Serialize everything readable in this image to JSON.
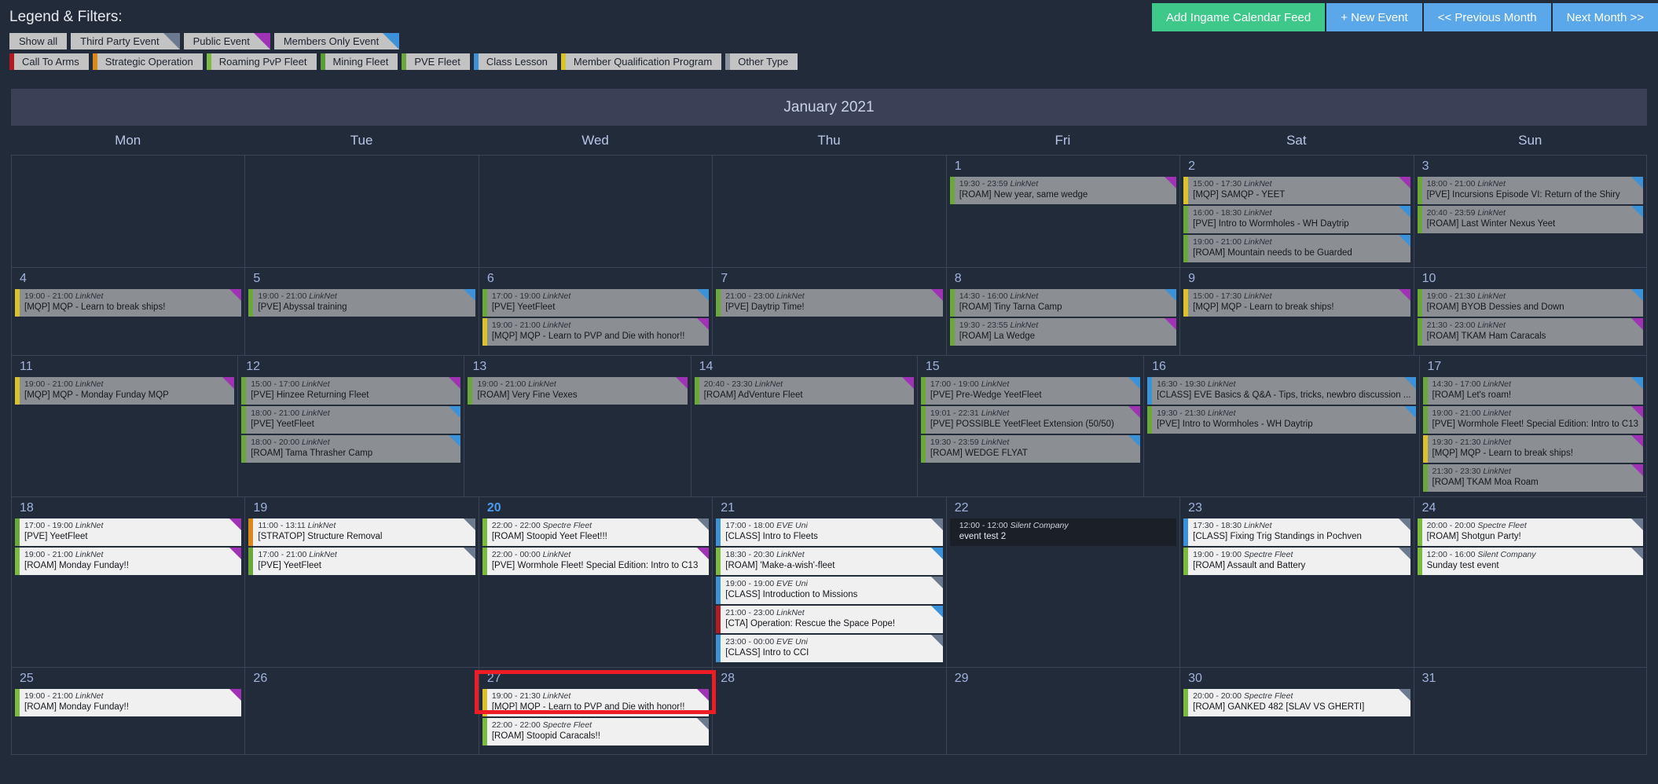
{
  "legend": {
    "title": "Legend & Filters:",
    "visibility_filters": [
      {
        "label": "Show all",
        "corner": null
      },
      {
        "label": "Third Party Event",
        "corner": "#6b7a8f"
      },
      {
        "label": "Public Event",
        "corner": "#a033b5"
      },
      {
        "label": "Members Only Event",
        "corner": "#3b92d8"
      }
    ],
    "category_filters": [
      {
        "label": "Call To Arms",
        "color": "#b01c22"
      },
      {
        "label": "Strategic Operation",
        "color": "#d9881b"
      },
      {
        "label": "Roaming PvP Fleet",
        "color": "#7cbb3f"
      },
      {
        "label": "Mining Fleet",
        "color": "#5d9b35"
      },
      {
        "label": "PVE Fleet",
        "color": "#6aa83a"
      },
      {
        "label": "Class Lesson",
        "color": "#3b92d8"
      },
      {
        "label": "Member Qualification Program",
        "color": "#d9c22b"
      },
      {
        "label": "Other Type",
        "color": "#8a949f"
      }
    ]
  },
  "actions": [
    {
      "label": "Add Ingame Calendar Feed",
      "style": "green"
    },
    {
      "label": "+ New Event",
      "style": "blue"
    },
    {
      "label": "<< Previous Month",
      "style": "blue"
    },
    {
      "label": "Next Month >>",
      "style": "blue"
    }
  ],
  "calendar": {
    "month_title": "January 2021",
    "weekdays": [
      "Mon",
      "Tue",
      "Wed",
      "Thu",
      "Fri",
      "Sat",
      "Sun"
    ],
    "today": 20,
    "weeks": [
      [
        {
          "day": ""
        },
        {
          "day": ""
        },
        {
          "day": ""
        },
        {
          "day": ""
        },
        {
          "day": "1",
          "events": [
            {
              "time": "19:30 - 23:59",
              "source": "LinkNet",
              "title": "[ROAM] New year, same wedge",
              "color": "#6aa83a",
              "corner": "#a033b5",
              "state": "past"
            }
          ]
        },
        {
          "day": "2",
          "events": [
            {
              "time": "15:00 - 17:30",
              "source": "LinkNet",
              "title": "[MQP] SAMQP - YEET",
              "color": "#d9c22b",
              "corner": "#a033b5",
              "state": "past"
            },
            {
              "time": "16:00 - 18:30",
              "source": "LinkNet",
              "title": "[PVE] Intro to Wormholes - WH Daytrip",
              "color": "#6aa83a",
              "corner": "#3b92d8",
              "state": "past"
            },
            {
              "time": "19:00 - 21:00",
              "source": "LinkNet",
              "title": "[ROAM] Mountain needs to be Guarded",
              "color": "#6aa83a",
              "corner": "#3b92d8",
              "state": "past"
            }
          ]
        },
        {
          "day": "3",
          "events": [
            {
              "time": "18:00 - 21:00",
              "source": "LinkNet",
              "title": "[PVE] Incursions Episode VI: Return of the Shiry",
              "color": "#6aa83a",
              "corner": "#3b92d8",
              "state": "past"
            },
            {
              "time": "20:40 - 23:59",
              "source": "LinkNet",
              "title": "[ROAM] Last Winter Nexus Yeet",
              "color": "#6aa83a",
              "corner": "#3b92d8",
              "state": "past"
            }
          ]
        }
      ],
      [
        {
          "day": "4",
          "events": [
            {
              "time": "19:00 - 21:00",
              "source": "LinkNet",
              "title": "[MQP] MQP - Learn to break ships!",
              "color": "#d9c22b",
              "corner": "#a033b5",
              "state": "past"
            }
          ]
        },
        {
          "day": "5",
          "events": [
            {
              "time": "19:00 - 21:00",
              "source": "LinkNet",
              "title": "[PVE] Abyssal training",
              "color": "#6aa83a",
              "corner": "#3b92d8",
              "state": "past"
            }
          ]
        },
        {
          "day": "6",
          "events": [
            {
              "time": "17:00 - 19:00",
              "source": "LinkNet",
              "title": "[PVE] YeetFleet",
              "color": "#6aa83a",
              "corner": "#3b92d8",
              "state": "past"
            },
            {
              "time": "19:00 - 21:00",
              "source": "LinkNet",
              "title": "[MQP] MQP - Learn to PVP and Die with honor!!",
              "color": "#d9c22b",
              "corner": "#a033b5",
              "state": "past"
            }
          ]
        },
        {
          "day": "7",
          "events": [
            {
              "time": "21:00 - 23:00",
              "source": "LinkNet",
              "title": "[PVE] Daytrip Time!",
              "color": "#6aa83a",
              "corner": "#a033b5",
              "state": "past"
            }
          ]
        },
        {
          "day": "8",
          "events": [
            {
              "time": "14:30 - 16:00",
              "source": "LinkNet",
              "title": "[ROAM] Tiny Tarna Camp",
              "color": "#6aa83a",
              "corner": "#3b92d8",
              "state": "past"
            },
            {
              "time": "19:30 - 23:55",
              "source": "LinkNet",
              "title": "[ROAM] La Wedge",
              "color": "#6aa83a",
              "corner": "#a033b5",
              "state": "past"
            }
          ]
        },
        {
          "day": "9",
          "events": [
            {
              "time": "15:00 - 17:30",
              "source": "LinkNet",
              "title": "[MQP] MQP - Learn to break ships!",
              "color": "#d9c22b",
              "corner": "#a033b5",
              "state": "past"
            }
          ]
        },
        {
          "day": "10",
          "events": [
            {
              "time": "19:00 - 21:30",
              "source": "LinkNet",
              "title": "[ROAM] BYOB Dessies and Down",
              "color": "#6aa83a",
              "corner": "#3b92d8",
              "state": "past"
            },
            {
              "time": "21:30 - 23:00",
              "source": "LinkNet",
              "title": "[ROAM] TKAM Ham Caracals",
              "color": "#6aa83a",
              "corner": "#a033b5",
              "state": "past"
            }
          ]
        }
      ],
      [
        {
          "day": "11",
          "events": [
            {
              "time": "19:00 - 21:00",
              "source": "LinkNet",
              "title": "[MQP] MQP - Monday Funday MQP",
              "color": "#d9c22b",
              "corner": "#a033b5",
              "state": "past"
            }
          ]
        },
        {
          "day": "12",
          "events": [
            {
              "time": "15:00 - 17:00",
              "source": "LinkNet",
              "title": "[PVE] Hinzee Returning Fleet",
              "color": "#6aa83a",
              "corner": "#a033b5",
              "state": "past"
            },
            {
              "time": "18:00 - 21:00",
              "source": "LinkNet",
              "title": "[PVE] YeetFleet",
              "color": "#6aa83a",
              "corner": "#3b92d8",
              "state": "past"
            },
            {
              "time": "18:00 - 20:00",
              "source": "LinkNet",
              "title": "[ROAM] Tama Thrasher Camp",
              "color": "#6aa83a",
              "corner": "#3b92d8",
              "state": "past"
            }
          ]
        },
        {
          "day": "13",
          "events": [
            {
              "time": "19:00 - 21:00",
              "source": "LinkNet",
              "title": "[ROAM] Very Fine Vexes",
              "color": "#6aa83a",
              "corner": "#a033b5",
              "state": "past"
            }
          ]
        },
        {
          "day": "14",
          "events": [
            {
              "time": "20:40 - 23:30",
              "source": "LinkNet",
              "title": "[ROAM] AdVenture Fleet",
              "color": "#6aa83a",
              "corner": "#a033b5",
              "state": "past"
            }
          ]
        },
        {
          "day": "15",
          "events": [
            {
              "time": "17:00 - 19:00",
              "source": "LinkNet",
              "title": "[PVE] Pre-Wedge YeetFleet",
              "color": "#6aa83a",
              "corner": "#3b92d8",
              "state": "past"
            },
            {
              "time": "19:01 - 22:31",
              "source": "LinkNet",
              "title": "[PVE] POSSIBLE YeetFleet Extension (50/50)",
              "color": "#6aa83a",
              "corner": "#a033b5",
              "state": "past"
            },
            {
              "time": "19:30 - 23:59",
              "source": "LinkNet",
              "title": "[ROAM] WEDGE FLYAT",
              "color": "#6aa83a",
              "corner": "#3b92d8",
              "state": "past"
            }
          ]
        },
        {
          "day": "16",
          "events": [
            {
              "time": "16:30 - 19:30",
              "source": "LinkNet",
              "title": "[CLASS] EVE Basics & Q&A - Tips, tricks, newbro discussion ...",
              "color": "#3b92d8",
              "corner": "#3b92d8",
              "state": "past"
            },
            {
              "time": "19:30 - 21:30",
              "source": "LinkNet",
              "title": "[PVE] Intro to Wormholes - WH Daytrip",
              "color": "#6aa83a",
              "corner": "#3b92d8",
              "state": "past"
            }
          ]
        },
        {
          "day": "17",
          "events": [
            {
              "time": "14:30 - 17:00",
              "source": "LinkNet",
              "title": "[ROAM] Let's roam!",
              "color": "#6aa83a",
              "corner": "#3b92d8",
              "state": "past"
            },
            {
              "time": "19:00 - 21:00",
              "source": "LinkNet",
              "title": "[PVE] Wormhole Fleet! Special Edition: Intro to C13",
              "color": "#6aa83a",
              "corner": "#a033b5",
              "state": "past"
            },
            {
              "time": "19:30 - 21:30",
              "source": "LinkNet",
              "title": "[MQP] MQP - Learn to break ships!",
              "color": "#d9c22b",
              "corner": "#a033b5",
              "state": "past"
            },
            {
              "time": "21:30 - 23:30",
              "source": "LinkNet",
              "title": "[ROAM] TKAM Moa Roam",
              "color": "#6aa83a",
              "corner": "#a033b5",
              "state": "past"
            }
          ]
        }
      ],
      [
        {
          "day": "18",
          "events": [
            {
              "time": "17:00 - 19:00",
              "source": "LinkNet",
              "title": "[PVE] YeetFleet",
              "color": "#6aa83a",
              "corner": "#a033b5",
              "state": "future"
            },
            {
              "time": "19:00 - 21:00",
              "source": "LinkNet",
              "title": "[ROAM] Monday Funday!!",
              "color": "#7cbb3f",
              "corner": "#a033b5",
              "state": "future"
            }
          ]
        },
        {
          "day": "19",
          "events": [
            {
              "time": "11:00 - 13:11",
              "source": "LinkNet",
              "title": "[STRATOP] Structure Removal",
              "color": "#d9881b",
              "corner": "#6b7a8f",
              "state": "future"
            },
            {
              "time": "17:00 - 21:00",
              "source": "LinkNet",
              "title": "[PVE] YeetFleet",
              "color": "#6aa83a",
              "corner": "#6b7a8f",
              "state": "future"
            }
          ]
        },
        {
          "day": "20",
          "today": true,
          "events": [
            {
              "time": "22:00 - 22:00",
              "source": "Spectre Fleet",
              "title": "[ROAM] Stoopid Yeet Fleet!!!",
              "color": "#7cbb3f",
              "corner": "#6b7a8f",
              "state": "future"
            },
            {
              "time": "22:00 - 00:00",
              "source": "LinkNet",
              "title": "[PVE] Wormhole Fleet! Special Edition: Intro to C13",
              "color": "#7cbb3f",
              "corner": "#a033b5",
              "state": "future"
            }
          ]
        },
        {
          "day": "21",
          "events": [
            {
              "time": "17:00 - 18:00",
              "source": "EVE Uni",
              "title": "[CLASS] Intro to Fleets",
              "color": "#3b92d8",
              "corner": "#6b7a8f",
              "state": "future"
            },
            {
              "time": "18:30 - 20:30",
              "source": "LinkNet",
              "title": "[ROAM] 'Make-a-wish'-fleet",
              "color": "#7cbb3f",
              "corner": "#3b92d8",
              "state": "future"
            },
            {
              "time": "19:00 - 19:00",
              "source": "EVE Uni",
              "title": "[CLASS] Introduction to Missions",
              "color": "#3b92d8",
              "corner": "#6b7a8f",
              "state": "future"
            },
            {
              "time": "21:00 - 23:00",
              "source": "LinkNet",
              "title": "[CTA] Operation: Rescue the Space Pope!",
              "color": "#b01c22",
              "corner": "#3b92d8",
              "state": "future"
            },
            {
              "time": "23:00 - 00:00",
              "source": "EVE Uni",
              "title": "[CLASS] Intro to CCI",
              "color": "#3b92d8",
              "corner": "#6b7a8f",
              "state": "future"
            }
          ]
        },
        {
          "day": "22",
          "events": [
            {
              "time": "12:00 - 12:00",
              "source": "Silent Company",
              "title": "event test 2",
              "color": "#1b1f27",
              "corner": null,
              "state": "dark"
            }
          ]
        },
        {
          "day": "23",
          "events": [
            {
              "time": "17:30 - 18:30",
              "source": "LinkNet",
              "title": "[CLASS] Fixing Trig Standings in Pochven",
              "color": "#3b92d8",
              "corner": "#6b7a8f",
              "state": "future"
            },
            {
              "time": "19:00 - 19:00",
              "source": "Spectre Fleet",
              "title": "[ROAM] Assault and Battery",
              "color": "#7cbb3f",
              "corner": "#6b7a8f",
              "state": "future"
            }
          ]
        },
        {
          "day": "24",
          "events": [
            {
              "time": "20:00 - 20:00",
              "source": "Spectre Fleet",
              "title": "[ROAM] Shotgun Party!",
              "color": "#7cbb3f",
              "corner": "#6b7a8f",
              "state": "future"
            },
            {
              "time": "12:00 - 16:00",
              "source": "Silent Company",
              "title": "Sunday test event",
              "color": "#7cbb3f",
              "corner": "#6b7a8f",
              "state": "future"
            }
          ]
        }
      ],
      [
        {
          "day": "25",
          "events": [
            {
              "time": "19:00 - 21:00",
              "source": "LinkNet",
              "title": "[ROAM] Monday Funday!!",
              "color": "#7cbb3f",
              "corner": "#a033b5",
              "state": "future"
            }
          ]
        },
        {
          "day": "26",
          "events": []
        },
        {
          "day": "27",
          "highlighted": true,
          "events": [
            {
              "time": "19:00 - 21:30",
              "source": "LinkNet",
              "title": "[MQP] MQP - Learn to PVP and Die with honor!!",
              "color": "#d9c22b",
              "corner": "#a033b5",
              "state": "future"
            },
            {
              "time": "22:00 - 22:00",
              "source": "Spectre Fleet",
              "title": "[ROAM] Stoopid Caracals!!",
              "color": "#7cbb3f",
              "corner": "#6b7a8f",
              "state": "future"
            }
          ]
        },
        {
          "day": "28",
          "events": []
        },
        {
          "day": "29",
          "events": []
        },
        {
          "day": "30",
          "events": [
            {
              "time": "20:00 - 20:00",
              "source": "Spectre Fleet",
              "title": "[ROAM] GANKED 482 [SLAV VS GHERTI]",
              "color": "#7cbb3f",
              "corner": "#6b7a8f",
              "state": "future"
            }
          ]
        },
        {
          "day": "31",
          "events": []
        }
      ]
    ]
  }
}
